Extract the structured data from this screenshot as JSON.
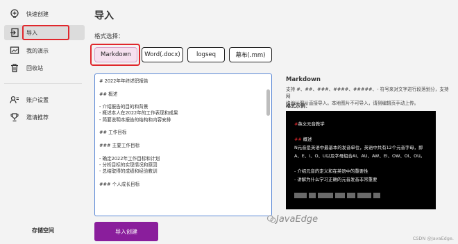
{
  "sidebar": {
    "items": [
      {
        "label": "快速创建",
        "icon": "bulb-plus-icon"
      },
      {
        "label": "导入",
        "icon": "import-icon"
      },
      {
        "label": "我的演示",
        "icon": "slides-icon"
      },
      {
        "label": "回收站",
        "icon": "trash-icon"
      },
      {
        "label": "账户设置",
        "icon": "account-icon"
      },
      {
        "label": "邀请推荐",
        "icon": "trophy-icon"
      }
    ],
    "storage_label": "存储空间"
  },
  "main": {
    "title": "导入",
    "format_label": "格式选择：",
    "formats": [
      "Markdown",
      "Word(.docx)",
      "logseq",
      "幕布(.mm)"
    ],
    "selected_format": "Markdown",
    "editor_lines": [
      "# 2022年年终述职报告",
      "",
      "## 概述",
      "",
      "- 介绍报告的目的和背景",
      "- 概述本人在2022年的工作表现和成果",
      "- 简要说明本报告的结构和内容安排",
      "",
      "## 工作目标",
      "",
      "### 主要工作目标",
      "",
      "- 确定2022年工作目标和计划",
      "- 分析目标的实现情况和原因",
      "- 总结取得的成绩和经验教训",
      "",
      "### 个人成长目标"
    ],
    "submit_label": "导入创建"
  },
  "info": {
    "title": "Markdown",
    "desc_line1": "支持 #、##、###、####、#####、- 符号来对文字进行段落划分，支持网",
    "desc_line2": "络地址图片直接导入。本地图片不可导入，请到编辑页手动上传。",
    "example_label": "格式示例：",
    "example": {
      "line1": "英文元音教学",
      "line1_prefix": "#",
      "line2_prefix": "##",
      "line2": " 概述",
      "line3": "  N元音是英语中最基本的发音单位，英语中共有12个元音字母，即",
      "line4": "A、E、I、O、U以及字母组合AI、AU、AW、EI、OW、OI、OU。",
      "line5": "- 介绍元音的定义和在英语中的重要性",
      "line6": "- 讲解为什么学习正确的元音发音非常重要"
    }
  },
  "watermark": "JavaEdge",
  "credit": "CSDN @JavaEdge.",
  "colors": {
    "accent_purple": "#8a1e9c",
    "highlight_red": "#e0272c",
    "selected_pink": "#f6e0ef",
    "editor_border": "#5a88d6",
    "example_hash_red": "#e0272c"
  }
}
